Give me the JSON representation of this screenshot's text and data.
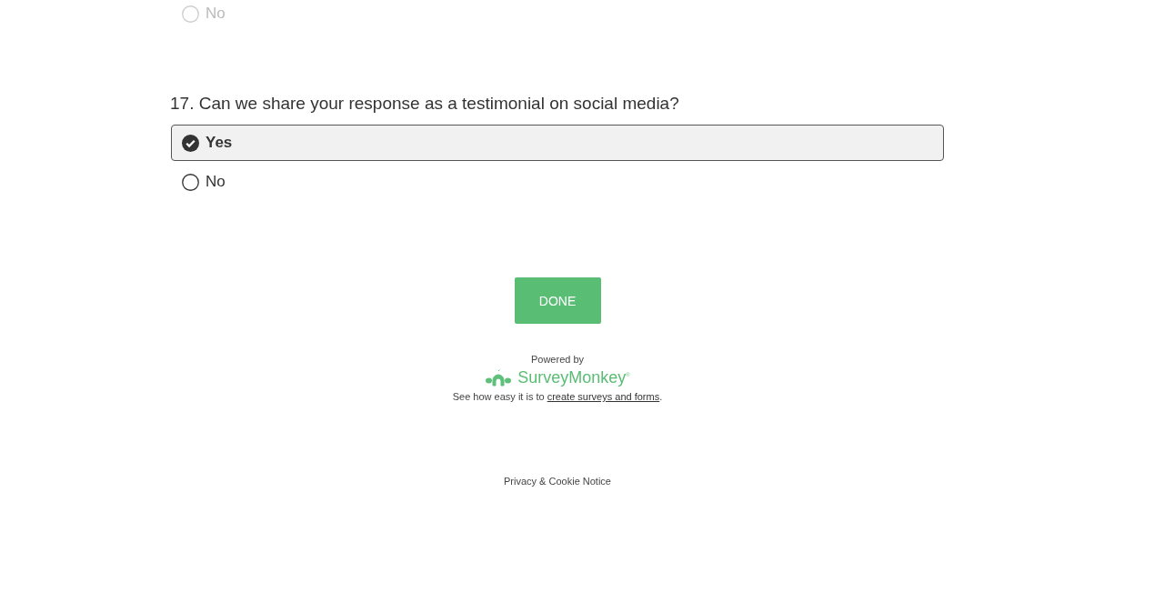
{
  "previous_question": {
    "disabled": true,
    "options": [
      {
        "label": "No",
        "selected": false
      }
    ]
  },
  "question": {
    "title": "17. Can we share your response as a testimonial on social media?",
    "disabled": false,
    "options": [
      {
        "label": "Yes",
        "selected": true
      },
      {
        "label": "No",
        "selected": false
      }
    ]
  },
  "done_button": "DONE",
  "footer": {
    "powered_by": "Powered by",
    "brand": "SurveyMonkey",
    "brand_mark": "®",
    "note_before": "See how easy it is to ",
    "note_link": "create surveys and forms",
    "note_after": ".",
    "privacy": "Privacy & Cookie Notice"
  }
}
